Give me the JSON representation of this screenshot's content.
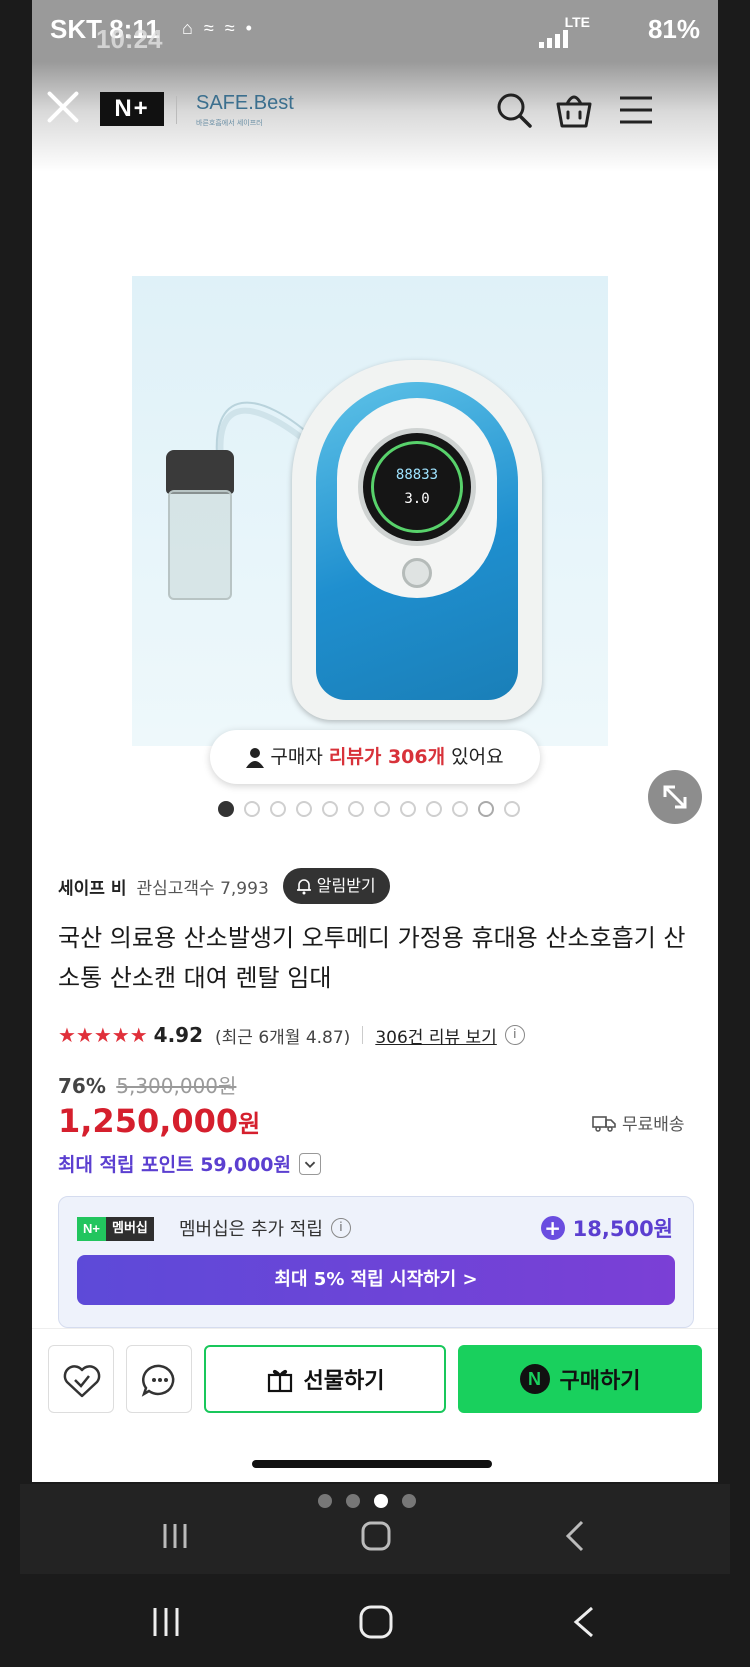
{
  "status": {
    "carrier_time": "SKT 8:11",
    "ghost_time": "10:24",
    "net": "LTE",
    "battery": "81%"
  },
  "header": {
    "logo": "N+",
    "brand_name": "SAFE.Best",
    "brand_sub": "바른호흡에서 세이프러"
  },
  "gallery": {
    "review_prefix": "구매자",
    "review_highlight": "리뷰가 306개",
    "review_suffix": "있어요",
    "dot_count": 12,
    "active_index": 0,
    "display_value": "88833",
    "display_flow": "3.0"
  },
  "seller": {
    "name": "세이프 비",
    "followers": "관심고객수 7,993",
    "alarm_label": "알림받기"
  },
  "product": {
    "title": "국산 의료용 산소발생기 오투메디 가정용 휴대용 산소호흡기 산소통 산소캔 대여 렌탈 임대",
    "stars": "★★★★★",
    "rating": "4.92",
    "recent_rating": "(최근 6개월 4.87)",
    "review_link": "306건 리뷰 보기",
    "discount": "76%",
    "original_price": "5,300,000원",
    "sale_price": "1,250,000",
    "sale_unit": "원",
    "shipping": "무료배송",
    "points": "최대 적립 포인트 59,000원"
  },
  "membership": {
    "badge_n": "N+",
    "badge_label": "멤버십",
    "text": "멤버십은 추가 적립",
    "bonus": "18,500원",
    "cta": "최대 5% 적립 시작하기 >"
  },
  "actions": {
    "gift": "선물하기",
    "buy": "구매하기",
    "npay": "N"
  },
  "colors": {
    "price_red": "#d51f2d",
    "purple": "#5b3fd0",
    "naver_green": "#19d05d"
  }
}
